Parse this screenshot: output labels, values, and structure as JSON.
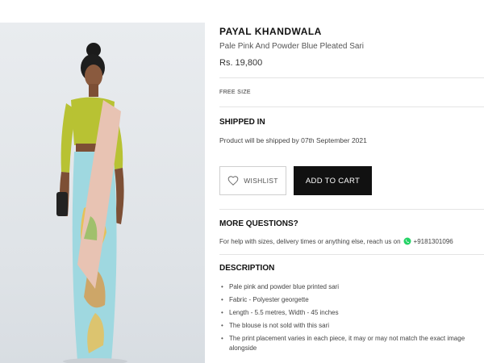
{
  "product": {
    "brand": "PAYAL KHANDWALA",
    "name": "Pale Pink And Powder Blue Pleated Sari",
    "price": "Rs. 19,800",
    "size": "FREE SIZE"
  },
  "shipping": {
    "heading": "SHIPPED IN",
    "text": "Product will be shipped by 07th September 2021"
  },
  "actions": {
    "wishlist_label": "WISHLIST",
    "add_to_cart_label": "ADD TO CART"
  },
  "questions": {
    "heading": "MORE QUESTIONS?",
    "text": "For help with sizes, delivery times or anything else, reach us on",
    "phone": "+9181301096"
  },
  "description": {
    "heading": "DESCRIPTION",
    "items": [
      "Pale pink and powder blue printed sari",
      "Fabric - Polyester georgette",
      "Length - 5.5 metres, Width - 45 inches",
      "The blouse is not sold with this sari",
      "The print placement varies in each piece, it may or may not match the exact image alongside"
    ]
  },
  "colors": {
    "button_dark": "#111111",
    "whatsapp_green": "#25D366",
    "blouse": "#b8c233",
    "sari_pink": "#e8c3b3",
    "sari_blue": "#8fd3dd"
  },
  "icons": {
    "wishlist": "heart-outline-icon",
    "contact": "whatsapp-icon"
  }
}
